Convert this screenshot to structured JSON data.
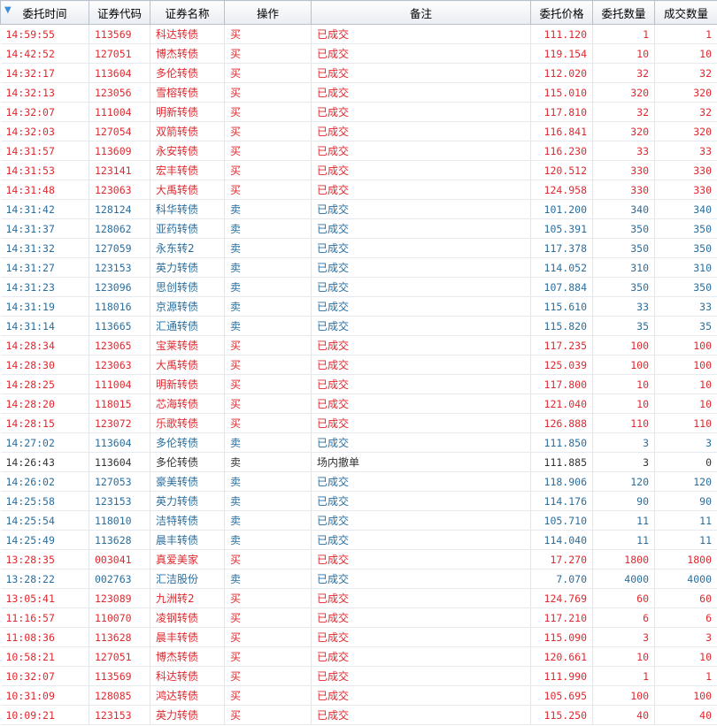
{
  "columns": {
    "time": "委托时间",
    "code": "证券代码",
    "name": "证券名称",
    "action": "操作",
    "note": "备注",
    "price": "委托价格",
    "qty": "委托数量",
    "filled": "成交数量"
  },
  "sort_indicator": "▼",
  "rows": [
    [
      "14:59:55",
      "113569",
      "科达转债",
      "买",
      "已成交",
      "111.120",
      "1",
      "1"
    ],
    [
      "14:42:52",
      "127051",
      "博杰转债",
      "买",
      "已成交",
      "119.154",
      "10",
      "10"
    ],
    [
      "14:32:17",
      "113604",
      "多伦转债",
      "买",
      "已成交",
      "112.020",
      "32",
      "32"
    ],
    [
      "14:32:13",
      "123056",
      "雪榕转债",
      "买",
      "已成交",
      "115.010",
      "320",
      "320"
    ],
    [
      "14:32:07",
      "111004",
      "明新转债",
      "买",
      "已成交",
      "117.810",
      "32",
      "32"
    ],
    [
      "14:32:03",
      "127054",
      "双箭转债",
      "买",
      "已成交",
      "116.841",
      "320",
      "320"
    ],
    [
      "14:31:57",
      "113609",
      "永安转债",
      "买",
      "已成交",
      "116.230",
      "33",
      "33"
    ],
    [
      "14:31:53",
      "123141",
      "宏丰转债",
      "买",
      "已成交",
      "120.512",
      "330",
      "330"
    ],
    [
      "14:31:48",
      "123063",
      "大禹转债",
      "买",
      "已成交",
      "124.958",
      "330",
      "330"
    ],
    [
      "14:31:42",
      "128124",
      "科华转债",
      "卖",
      "已成交",
      "101.200",
      "340",
      "340"
    ],
    [
      "14:31:37",
      "128062",
      "亚药转债",
      "卖",
      "已成交",
      "105.391",
      "350",
      "350"
    ],
    [
      "14:31:32",
      "127059",
      "永东转2",
      "卖",
      "已成交",
      "117.378",
      "350",
      "350"
    ],
    [
      "14:31:27",
      "123153",
      "英力转债",
      "卖",
      "已成交",
      "114.052",
      "310",
      "310"
    ],
    [
      "14:31:23",
      "123096",
      "思创转债",
      "卖",
      "已成交",
      "107.884",
      "350",
      "350"
    ],
    [
      "14:31:19",
      "118016",
      "京源转债",
      "卖",
      "已成交",
      "115.610",
      "33",
      "33"
    ],
    [
      "14:31:14",
      "113665",
      "汇通转债",
      "卖",
      "已成交",
      "115.820",
      "35",
      "35"
    ],
    [
      "14:28:34",
      "123065",
      "宝莱转债",
      "买",
      "已成交",
      "117.235",
      "100",
      "100"
    ],
    [
      "14:28:30",
      "123063",
      "大禹转债",
      "买",
      "已成交",
      "125.039",
      "100",
      "100"
    ],
    [
      "14:28:25",
      "111004",
      "明新转债",
      "买",
      "已成交",
      "117.800",
      "10",
      "10"
    ],
    [
      "14:28:20",
      "118015",
      "芯海转债",
      "买",
      "已成交",
      "121.040",
      "10",
      "10"
    ],
    [
      "14:28:15",
      "123072",
      "乐歌转债",
      "买",
      "已成交",
      "126.888",
      "110",
      "110"
    ],
    [
      "14:27:02",
      "113604",
      "多伦转债",
      "卖",
      "已成交",
      "111.850",
      "3",
      "3"
    ],
    [
      "14:26:43",
      "113604",
      "多伦转债",
      "卖",
      "场内撤单",
      "111.885",
      "3",
      "0"
    ],
    [
      "14:26:02",
      "127053",
      "豪美转债",
      "卖",
      "已成交",
      "118.906",
      "120",
      "120"
    ],
    [
      "14:25:58",
      "123153",
      "英力转债",
      "卖",
      "已成交",
      "114.176",
      "90",
      "90"
    ],
    [
      "14:25:54",
      "118010",
      "洁特转债",
      "卖",
      "已成交",
      "105.710",
      "11",
      "11"
    ],
    [
      "14:25:49",
      "113628",
      "晨丰转债",
      "卖",
      "已成交",
      "114.040",
      "11",
      "11"
    ],
    [
      "13:28:35",
      "003041",
      "真爱美家",
      "买",
      "已成交",
      "17.270",
      "1800",
      "1800"
    ],
    [
      "13:28:22",
      "002763",
      "汇洁股份",
      "卖",
      "已成交",
      "7.070",
      "4000",
      "4000"
    ],
    [
      "13:05:41",
      "123089",
      "九洲转2",
      "买",
      "已成交",
      "124.769",
      "60",
      "60"
    ],
    [
      "11:16:57",
      "110070",
      "凌钢转债",
      "买",
      "已成交",
      "117.210",
      "6",
      "6"
    ],
    [
      "11:08:36",
      "113628",
      "晨丰转债",
      "买",
      "已成交",
      "115.090",
      "3",
      "3"
    ],
    [
      "10:58:21",
      "127051",
      "博杰转债",
      "买",
      "已成交",
      "120.661",
      "10",
      "10"
    ],
    [
      "10:32:07",
      "113569",
      "科达转债",
      "买",
      "已成交",
      "111.990",
      "1",
      "1"
    ],
    [
      "10:31:09",
      "128085",
      "鸿达转债",
      "买",
      "已成交",
      "105.695",
      "100",
      "100"
    ],
    [
      "10:09:21",
      "123153",
      "英力转债",
      "买",
      "已成交",
      "115.250",
      "40",
      "40"
    ]
  ]
}
